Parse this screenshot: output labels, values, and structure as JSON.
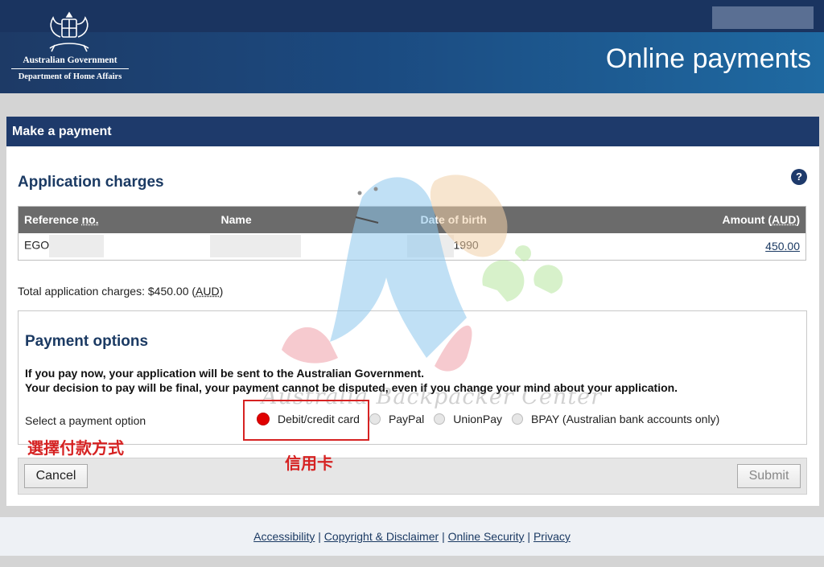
{
  "header": {
    "org_line1": "Australian Government",
    "org_line2": "Department of Home Affairs",
    "title": "Online payments"
  },
  "panel": {
    "title": "Make a payment"
  },
  "charges": {
    "heading": "Application charges",
    "help_icon": "?",
    "columns": {
      "reference": "Reference ",
      "reference_abbr": "no.",
      "name": "Name",
      "dob": "Date of birth",
      "amount": "Amount (",
      "amount_abbr": "AUD",
      "amount_close": ")"
    },
    "row": {
      "reference_prefix": "EGO",
      "dob_suffix": "1990",
      "amount": "450.00"
    },
    "total_prefix": "Total application charges: $450.00 (",
    "total_abbr": "AUD",
    "total_suffix": ")"
  },
  "payment_options": {
    "heading": "Payment options",
    "notice_line1": "If you pay now, your application will be sent to the Australian Government.",
    "notice_line2": "Your decision to pay will be final, your payment cannot be disputed, even if you change your mind about your application.",
    "select_label": "Select a payment option",
    "options": [
      {
        "label": "Debit/credit card",
        "selected": true
      },
      {
        "label": "PayPal",
        "selected": false
      },
      {
        "label": "UnionPay",
        "selected": false
      },
      {
        "label": "BPAY (Australian bank accounts only)",
        "selected": false
      }
    ]
  },
  "buttons": {
    "cancel": "Cancel",
    "submit": "Submit"
  },
  "annotations": {
    "select_method": "選擇付款方式",
    "credit_card": "信用卡",
    "color": "#d62222"
  },
  "watermark": "Australia Backpacker Center",
  "footer": {
    "links": [
      "Accessibility",
      "Copyright & Disclaimer",
      "Online Security",
      "Privacy"
    ],
    "separator": "|"
  },
  "colors": {
    "header_dark": "#1a3460",
    "panel_bar": "#1e3a6b",
    "heading_text": "#1b3a63",
    "table_header": "#6b6b6b",
    "selected_radio": "#e00000"
  }
}
